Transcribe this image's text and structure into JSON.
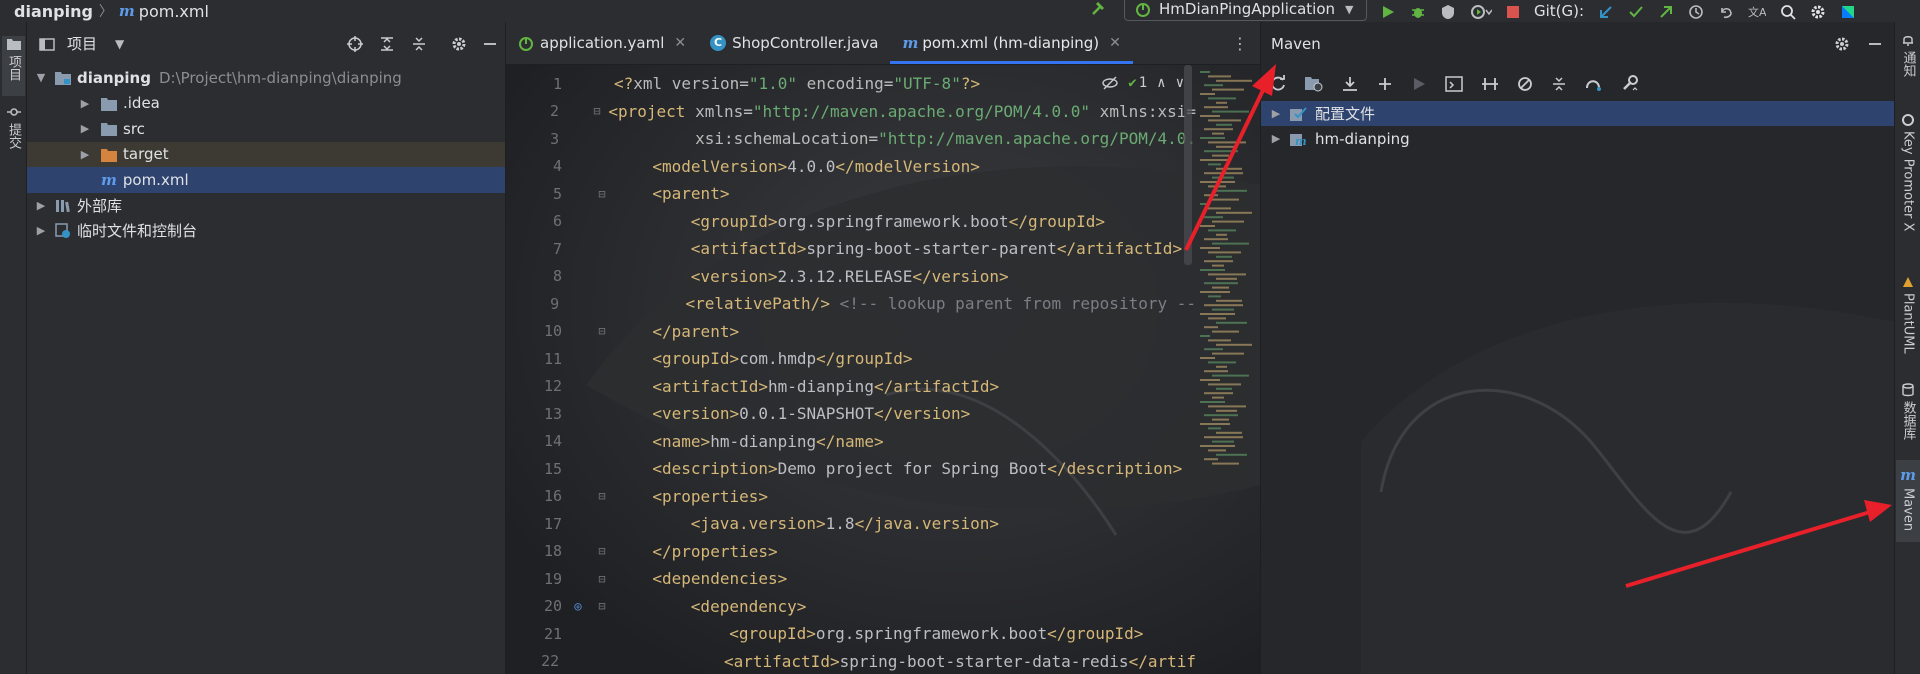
{
  "topbar": {
    "project": "dianping",
    "file": "pom.xml",
    "run_config": "HmDianPingApplication",
    "git_label": "Git(G):"
  },
  "left_stripe": {
    "project_tab": "项目",
    "commit_tab": "提交"
  },
  "project_panel": {
    "title": "项目",
    "tree": [
      {
        "label": "dianping",
        "path": "D:\\Project\\hm-dianping\\dianping",
        "depth": 0,
        "expanded": true,
        "icon": "module-folder-icon"
      },
      {
        "label": ".idea",
        "depth": 1,
        "expanded": false,
        "icon": "folder-icon"
      },
      {
        "label": "src",
        "depth": 1,
        "expanded": false,
        "icon": "folder-icon"
      },
      {
        "label": "target",
        "depth": 1,
        "expanded": false,
        "icon": "excluded-folder-icon"
      },
      {
        "label": "pom.xml",
        "depth": 1,
        "icon": "maven-file-icon"
      },
      {
        "label": "外部库",
        "depth": 0,
        "expanded": false,
        "icon": "library-icon"
      },
      {
        "label": "临时文件和控制台",
        "depth": 0,
        "expanded": false,
        "icon": "scratch-icon"
      }
    ]
  },
  "editor": {
    "tabs": [
      {
        "label": "application.yaml",
        "icon": "yaml-icon",
        "active": false
      },
      {
        "label": "ShopController.java",
        "icon": "class-icon",
        "active": false
      },
      {
        "label": "pom.xml (hm-dianping)",
        "icon": "maven-file-icon",
        "active": true
      }
    ],
    "inspection_count": "1",
    "lines": [
      {
        "n": "1",
        "indent": 0,
        "html": "<span class='decl'>&lt;?</span><span class='attr'>xml version</span><span class='src'>=</span><span class='val'>\"1.0\"</span><span class='attr'> encoding</span><span class='src'>=</span><span class='val'>\"UTF-8\"</span><span class='decl'>?&gt;</span>"
      },
      {
        "n": "2",
        "indent": 0,
        "html": "<span class='tag'>&lt;project </span><span class='attr'>xmlns</span><span class='src'>=</span><span class='val'>\"http://maven.apache.org/POM/4.0.0\"</span><span class='attr'> xmlns:xsi=</span>"
      },
      {
        "n": "3",
        "indent": 9,
        "html": "<span class='attr'>xsi:schemaLocation</span><span class='src'>=</span><span class='val'>\"http://maven.apache.org/POM/4.0.</span>"
      },
      {
        "n": "4",
        "indent": 4,
        "html": "<span class='tag'>&lt;modelVersion&gt;</span><span class='src'>4.0.0</span><span class='tag'>&lt;/modelVersion&gt;</span>"
      },
      {
        "n": "5",
        "indent": 4,
        "html": "<span class='tag'>&lt;parent&gt;</span>"
      },
      {
        "n": "6",
        "indent": 8,
        "html": "<span class='tag'>&lt;groupId&gt;</span><span class='src'>org.springframework.boot</span><span class='tag'>&lt;/groupId&gt;</span>"
      },
      {
        "n": "7",
        "indent": 8,
        "html": "<span class='tag'>&lt;artifactId&gt;</span><span class='src'>spring-boot-starter-parent</span><span class='tag'>&lt;/artifactId&gt;</span>"
      },
      {
        "n": "8",
        "indent": 8,
        "html": "<span class='tag'>&lt;version&gt;</span><span class='src'>2.3.12.RELEASE</span><span class='tag'>&lt;/version&gt;</span>"
      },
      {
        "n": "9",
        "indent": 8,
        "html": "<span class='tag'>&lt;relativePath/&gt;</span><span class='cmt'> &lt;!-- lookup parent from repository --</span>"
      },
      {
        "n": "10",
        "indent": 4,
        "html": "<span class='tag'>&lt;/parent&gt;</span>"
      },
      {
        "n": "11",
        "indent": 4,
        "html": "<span class='tag'>&lt;groupId&gt;</span><span class='src'>com.hmdp</span><span class='tag'>&lt;/groupId&gt;</span>"
      },
      {
        "n": "12",
        "indent": 4,
        "html": "<span class='tag'>&lt;artifactId&gt;</span><span class='src'>hm-dianping</span><span class='tag'>&lt;/artifactId&gt;</span>"
      },
      {
        "n": "13",
        "indent": 4,
        "html": "<span class='tag'>&lt;version&gt;</span><span class='src'>0.0.1-SNAPSHOT</span><span class='tag'>&lt;/version&gt;</span>"
      },
      {
        "n": "14",
        "indent": 4,
        "html": "<span class='tag'>&lt;name&gt;</span><span class='src'>hm-dianping</span><span class='tag'>&lt;/name&gt;</span>"
      },
      {
        "n": "15",
        "indent": 4,
        "html": "<span class='tag'>&lt;description&gt;</span><span class='src'>Demo project for Spring Boot</span><span class='tag'>&lt;/description&gt;</span>"
      },
      {
        "n": "16",
        "indent": 4,
        "html": "<span class='tag'>&lt;properties&gt;</span>"
      },
      {
        "n": "17",
        "indent": 8,
        "html": "<span class='tag'>&lt;java.version&gt;</span><span class='src'>1.8</span><span class='tag'>&lt;/java.version&gt;</span>"
      },
      {
        "n": "18",
        "indent": 4,
        "html": "<span class='tag'>&lt;/properties&gt;</span>"
      },
      {
        "n": "19",
        "indent": 4,
        "html": "<span class='tag'>&lt;dependencies&gt;</span>"
      },
      {
        "n": "20",
        "indent": 8,
        "html": "<span class='tag'>&lt;dependency&gt;</span>"
      },
      {
        "n": "21",
        "indent": 12,
        "html": "<span class='tag'>&lt;groupId&gt;</span><span class='src'>org.springframework.boot</span><span class='tag'>&lt;/groupId&gt;</span>"
      },
      {
        "n": "22",
        "indent": 12,
        "html": "<span class='tag'>&lt;artifactId&gt;</span><span class='src'>spring-boot-starter-data-redis</span><span class='tag'>&lt;/artif</span>"
      }
    ]
  },
  "maven_panel": {
    "title": "Maven",
    "tree": [
      {
        "label": "配置文件",
        "icon": "profiles-icon",
        "selected": true
      },
      {
        "label": "hm-dianping",
        "icon": "maven-project-icon",
        "selected": false
      }
    ]
  },
  "right_stripe": {
    "tabs": [
      "通知",
      "Key Promoter X",
      "PlantUML",
      "数据库",
      "Maven"
    ],
    "active": "Maven"
  },
  "colors": {
    "accent": "#3574f0",
    "annotation_arrow": "#e8202a",
    "selection": "#2e436e"
  }
}
